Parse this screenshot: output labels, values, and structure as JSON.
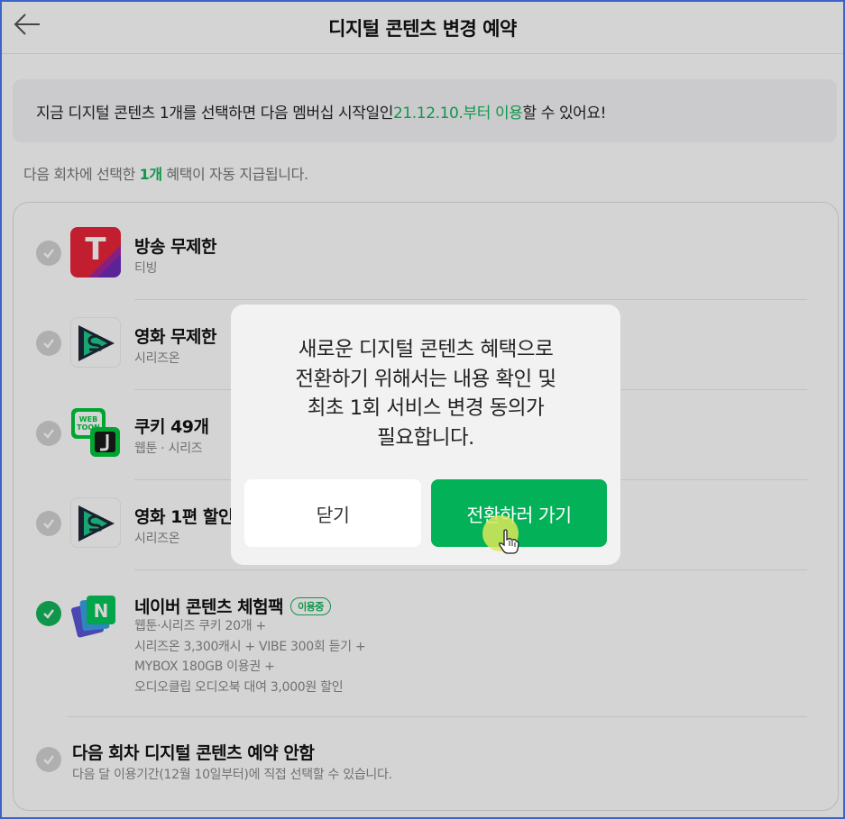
{
  "header": {
    "title": "디지털 콘텐츠 변경 예약"
  },
  "notice": {
    "pre": "지금 디지털 콘텐츠 1개를 선택하면 다음 멤버십 시작일인 ",
    "date": "21.12.10.부터 이용",
    "post": "할 수 있어요!"
  },
  "sub": {
    "pre": "다음 회차에 선택한 ",
    "count": "1개",
    "post": " 혜택이 자동 지급됩니다."
  },
  "items": [
    {
      "title": "방송 무제한",
      "sub": "티빙",
      "selected": false
    },
    {
      "title": "영화 무제한",
      "sub": "시리즈온",
      "selected": false
    },
    {
      "title": "쿠키 49개",
      "sub": "웹툰 · 시리즈",
      "selected": false
    },
    {
      "title": "영화 1편 할인",
      "sub": "시리즈온",
      "selected": false
    },
    {
      "title": "네이버 콘텐츠 체험팩",
      "badge": "이용중",
      "lines": [
        "웹툰·시리즈 쿠키 20개 +",
        "시리즈온 3,300캐시 + VIBE 300회 듣기 +",
        "MYBOX 180GB 이용권 +",
        "오디오클립 오디오북 대여 3,000원 할인"
      ],
      "selected": true
    },
    {
      "title": "다음 회차 디지털 콘텐츠 예약 안함",
      "sub": "다음 달 이용기간(12월 10일부터)에 직접 선택할 수 있습니다.",
      "selected": false
    }
  ],
  "logos": {
    "tving": "T",
    "webtoon": "WEB TOON",
    "naver": "N"
  },
  "modal": {
    "lines": [
      "새로운 디지털 콘텐츠 혜택으로",
      "전환하기 위해서는 내용 확인 및",
      "최초 1회 서비스 변경 동의가",
      "필요합니다."
    ],
    "close_label": "닫기",
    "go_label": "전환하러 가기"
  },
  "colors": {
    "accent": "#03b258",
    "frame": "#3a64c8",
    "tving": "#e8263a"
  }
}
